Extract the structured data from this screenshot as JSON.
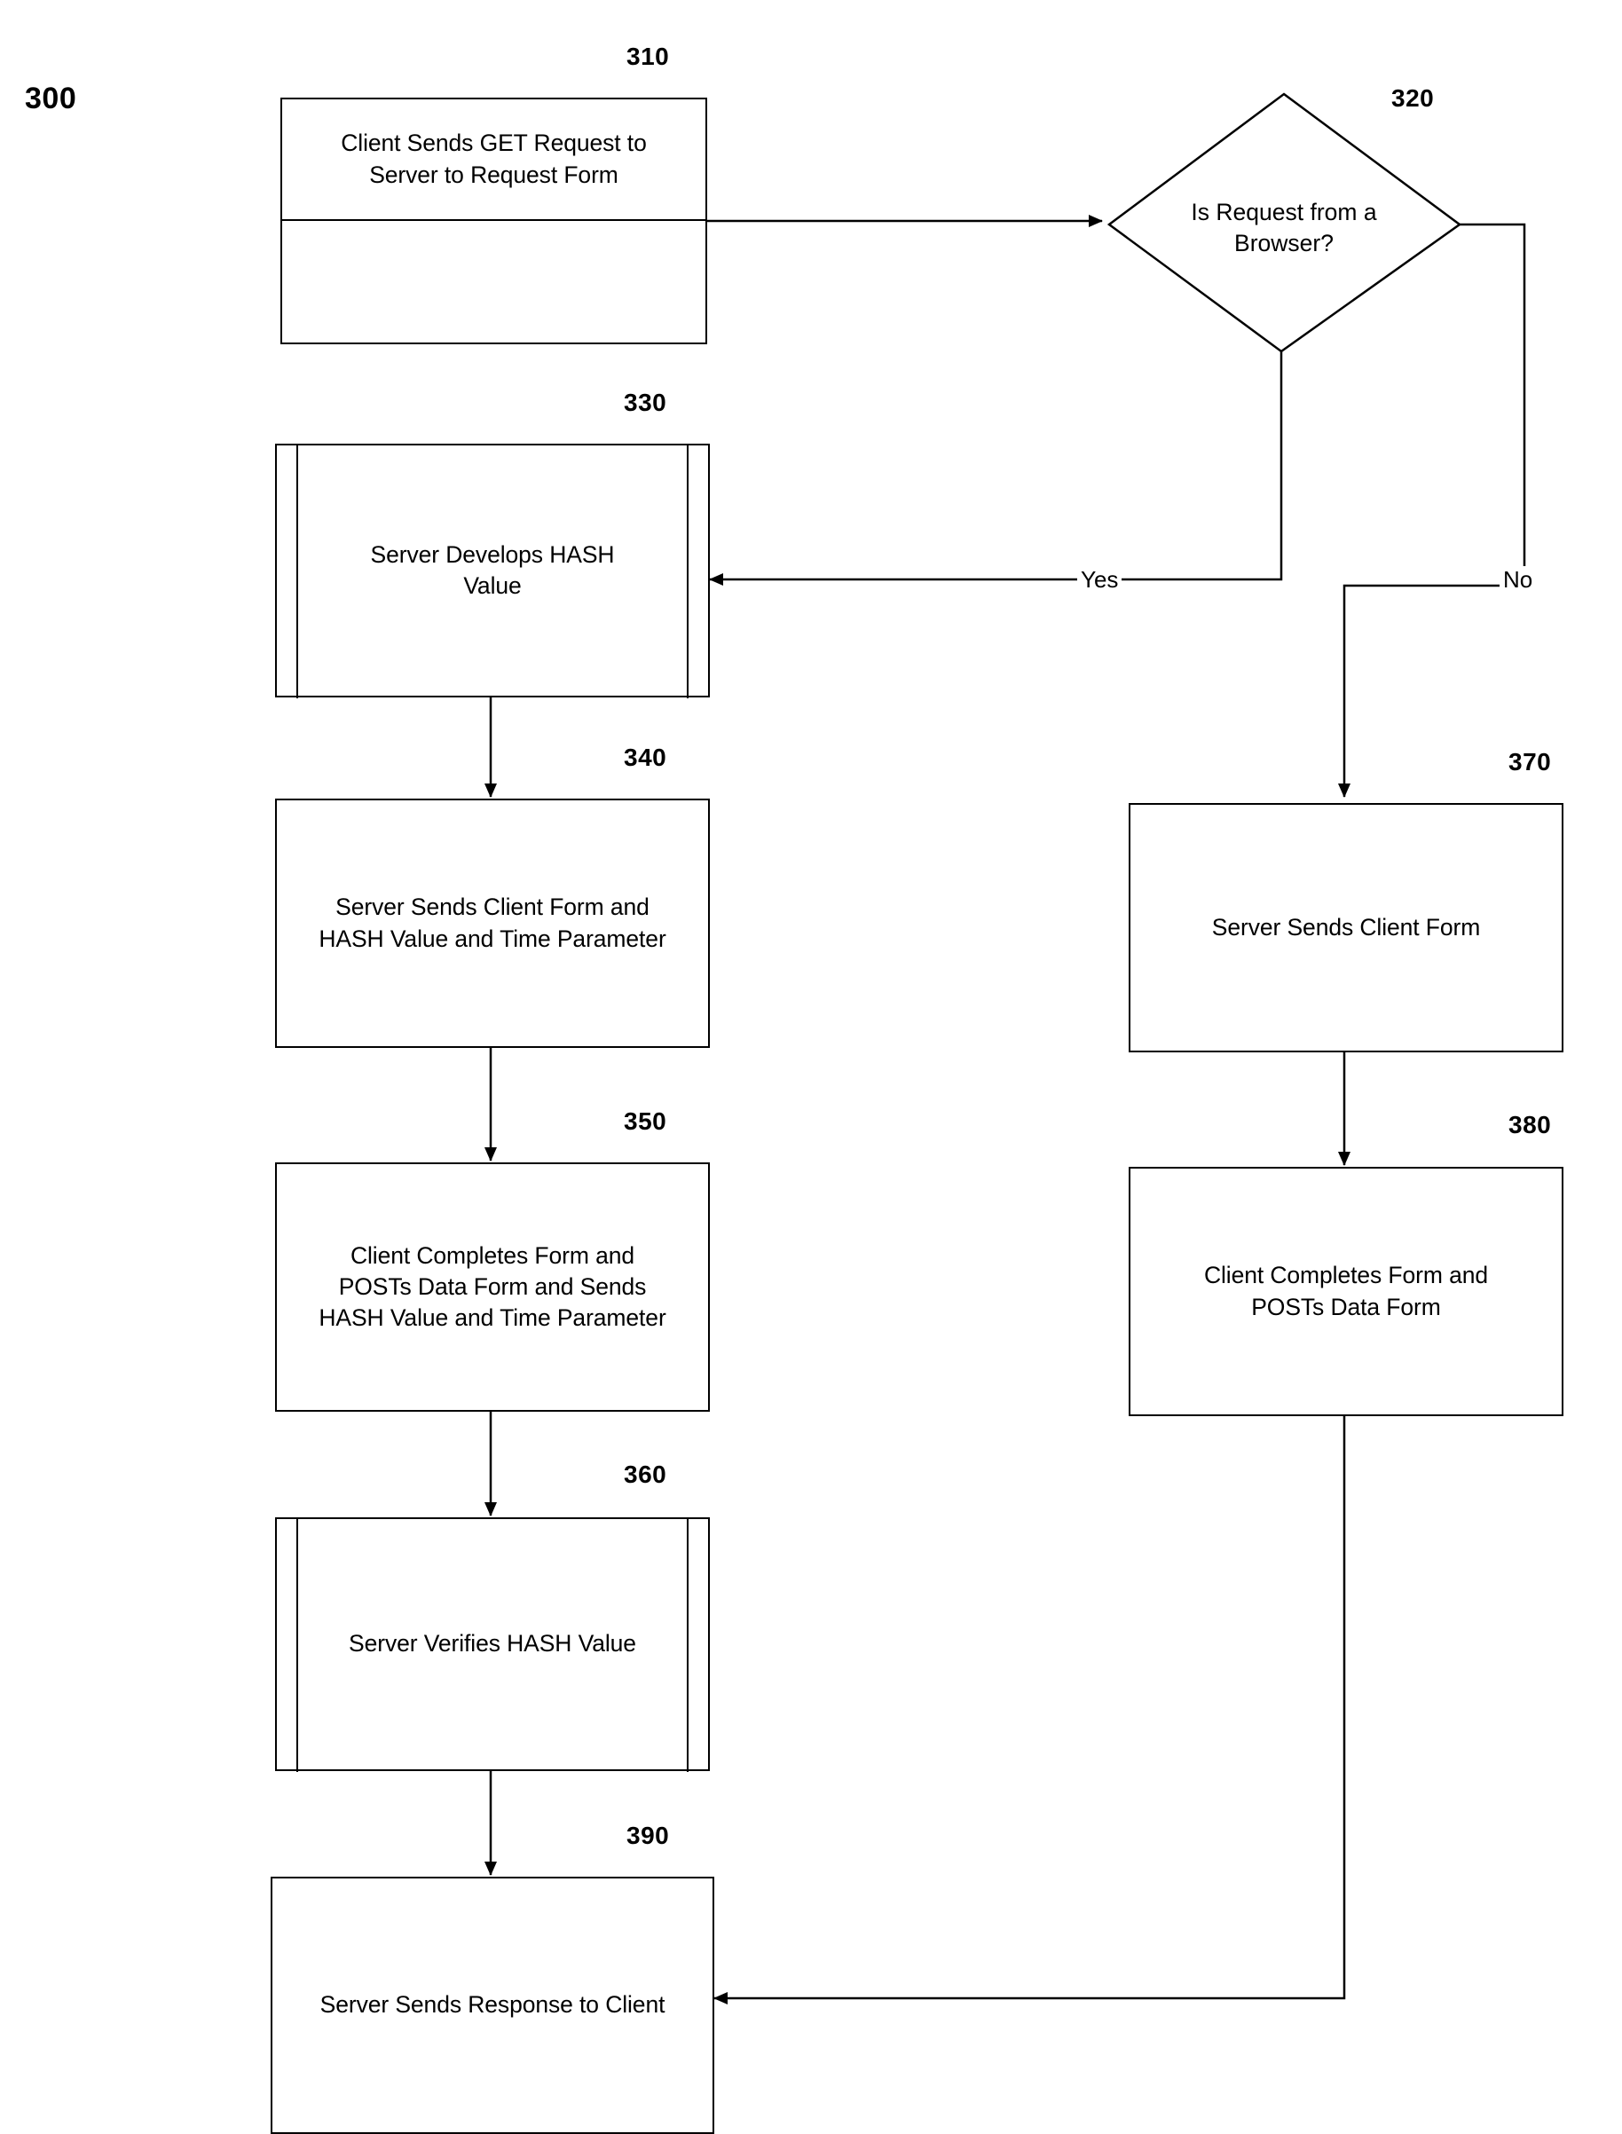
{
  "figure": {
    "number": "300"
  },
  "nodes": [
    {
      "id": "310",
      "ref": "310",
      "shape": "process",
      "text": "Client Sends GET Request to\nServer to Request Form"
    },
    {
      "id": "320",
      "ref": "320",
      "shape": "decision",
      "text": "Is Request from a\nBrowser?"
    },
    {
      "id": "330",
      "ref": "330",
      "shape": "predefined-process",
      "text": "Server Develops HASH\nValue"
    },
    {
      "id": "340",
      "ref": "340",
      "shape": "process",
      "text": "Server Sends Client Form and\nHASH Value and Time Parameter"
    },
    {
      "id": "350",
      "ref": "350",
      "shape": "process",
      "text": "Client Completes Form and\nPOSTs Data Form and Sends\nHASH Value and Time Parameter"
    },
    {
      "id": "360",
      "ref": "360",
      "shape": "predefined-process",
      "text": "Server Verifies HASH Value"
    },
    {
      "id": "370",
      "ref": "370",
      "shape": "process",
      "text": "Server Sends Client Form"
    },
    {
      "id": "380",
      "ref": "380",
      "shape": "process",
      "text": "Client Completes Form and\nPOSTs Data Form"
    },
    {
      "id": "390",
      "ref": "390",
      "shape": "process",
      "text": "Server Sends Response to Client"
    }
  ],
  "edge_labels": {
    "yes": "Yes",
    "no": "No"
  },
  "colors": {
    "stroke": "#000000",
    "fill": "#ffffff"
  }
}
